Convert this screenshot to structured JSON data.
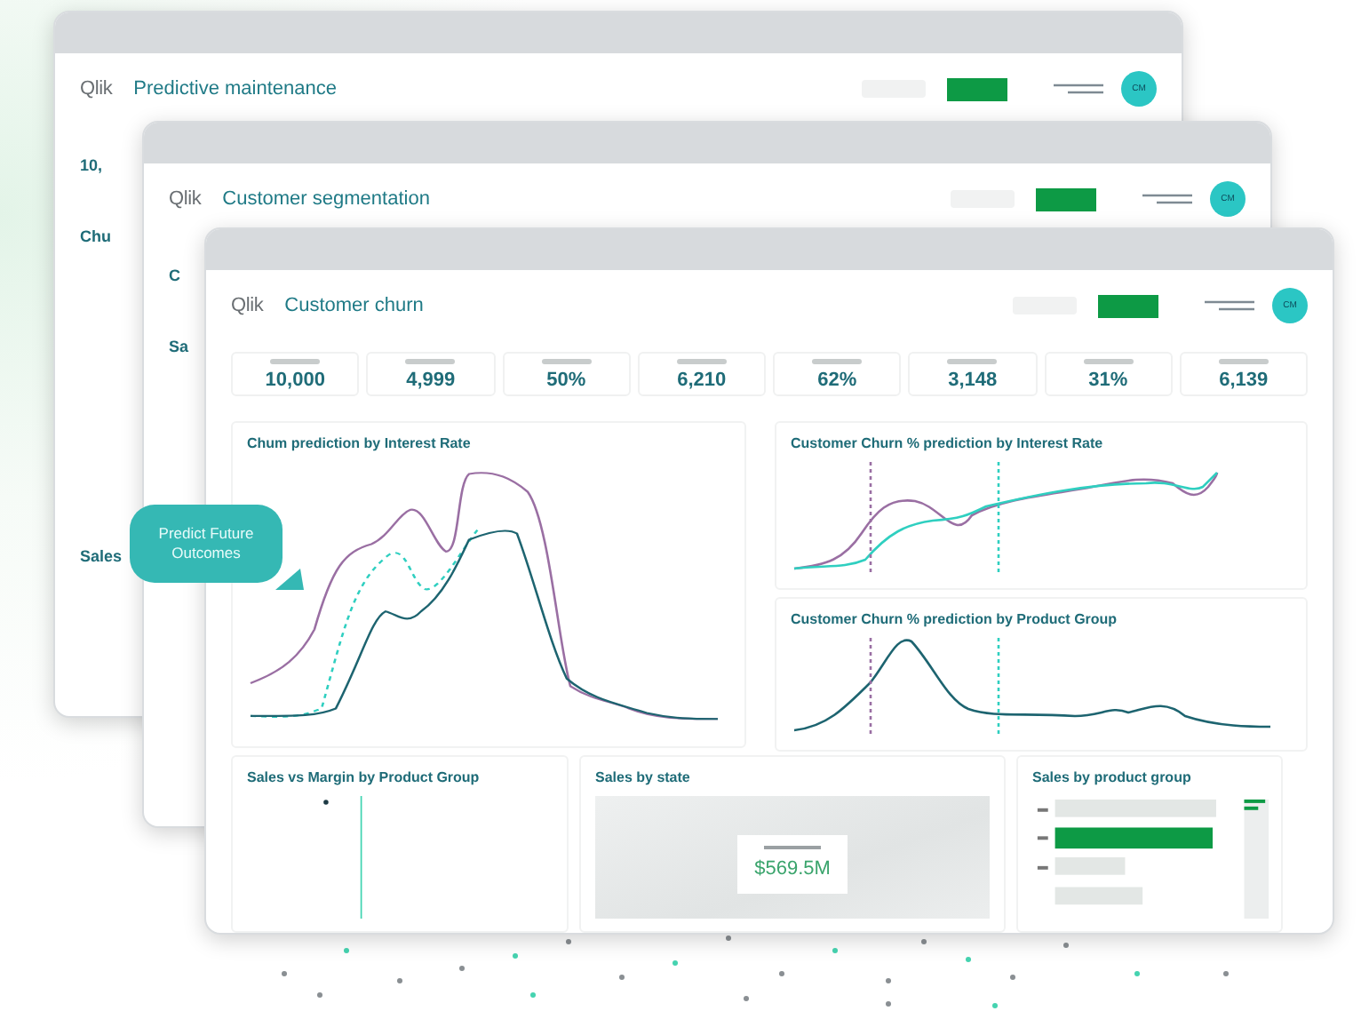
{
  "windows": [
    {
      "kind": "back",
      "logo": "Qlik",
      "title": "Predictive maintenance",
      "avatar": "CM",
      "fragments": [
        "10,",
        "Chu",
        "Sales"
      ]
    },
    {
      "kind": "back",
      "logo": "Qlik",
      "title": "Customer segmentation",
      "avatar": "CM",
      "fragments": [
        "C",
        "Sa"
      ]
    },
    {
      "kind": "front",
      "logo": "Qlik",
      "title": "Customer churn",
      "avatar": "CM",
      "kpis": [
        "10,000",
        "4,999",
        "50%",
        "6,210",
        "62%",
        "3,148",
        "31%",
        "6,139"
      ],
      "panels": [
        {
          "kind": "big-line",
          "title": "Chum prediction by Interest Rate"
        },
        {
          "kind": "two-line",
          "title": "Customer Churn % prediction by Interest Rate"
        },
        {
          "kind": "one-line",
          "title": "Customer Churn % prediction by Product Group"
        }
      ],
      "bottom": [
        {
          "kind": "scatter",
          "title": "Sales vs Margin by Product Group"
        },
        {
          "kind": "map",
          "title": "Sales by state",
          "value": "$569.5M"
        },
        {
          "kind": "bars",
          "title": "Sales by product group"
        }
      ]
    }
  ],
  "callout": {
    "text": "Predict Future Outcomes"
  }
}
